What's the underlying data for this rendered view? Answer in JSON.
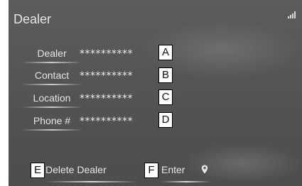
{
  "header": {
    "title": "Dealer",
    "signal_icon": "signal-icon"
  },
  "rows": [
    {
      "label": "Dealer",
      "value": "**********",
      "callout": "A"
    },
    {
      "label": "Contact",
      "value": "**********",
      "callout": "B"
    },
    {
      "label": "Location",
      "value": "**********",
      "callout": "C"
    },
    {
      "label": "Phone #",
      "value": "**********",
      "callout": "D"
    }
  ],
  "footer": {
    "delete_label": "Delete Dealer",
    "delete_callout": "E",
    "enter_label": "Enter",
    "enter_callout": "F",
    "enter_icon": "map-pin-icon"
  }
}
